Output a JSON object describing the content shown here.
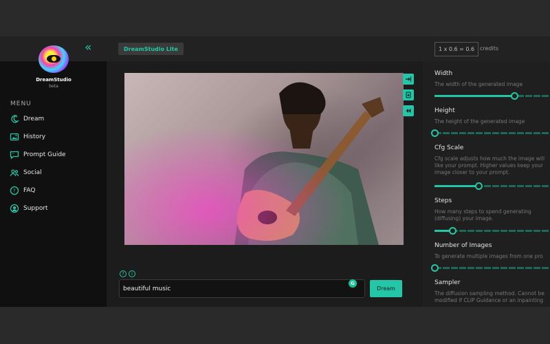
{
  "sidebar": {
    "brand": "DreamStudio",
    "brand_sub": "beta",
    "menu_title": "MENU",
    "items": [
      {
        "label": "Dream",
        "icon": "moon-sparkle-icon"
      },
      {
        "label": "History",
        "icon": "image-gallery-icon"
      },
      {
        "label": "Prompt Guide",
        "icon": "quote-bubble-icon"
      },
      {
        "label": "Social",
        "icon": "people-icon"
      },
      {
        "label": "FAQ",
        "icon": "question-circle-icon"
      },
      {
        "label": "Support",
        "icon": "support-icon"
      }
    ]
  },
  "header": {
    "badge": "DreamStudio Lite",
    "credits_formula": "1 x 0.6 = 0.6",
    "credits_label": "credits"
  },
  "tools": [
    "send-to-init-icon",
    "download-icon",
    "rewind-icon"
  ],
  "prompt": {
    "value": "beautiful music",
    "dream_label": "Dream",
    "grammarly_letter": "G",
    "help_q": "?",
    "help_i": "i"
  },
  "settings": [
    {
      "title": "Width",
      "desc": [
        "The width of the generated image"
      ],
      "fill": 0.58
    },
    {
      "title": "Height",
      "desc": [
        "The height of the generated image"
      ],
      "fill": 0.0
    },
    {
      "title": "Cfg Scale",
      "desc": [
        "Cfg scale adjusts how much the image will",
        "like your prompt. Higher values keep your",
        "image closer to your prompt."
      ],
      "fill": 0.32
    },
    {
      "title": "Steps",
      "desc": [
        "How many steps to spend generating",
        "(diffusing) your image."
      ],
      "fill": 0.13
    },
    {
      "title": "Number of Images",
      "desc": [
        "To generate multiple images from one pro"
      ],
      "fill": 0.0
    },
    {
      "title": "Sampler",
      "desc": [
        "The diffusion sampling method. Cannot be",
        "modified if CLIP Guidance or an inpainting"
      ]
    }
  ],
  "colors": {
    "accent": "#23c7a8",
    "sidebar_bg": "#101010"
  }
}
